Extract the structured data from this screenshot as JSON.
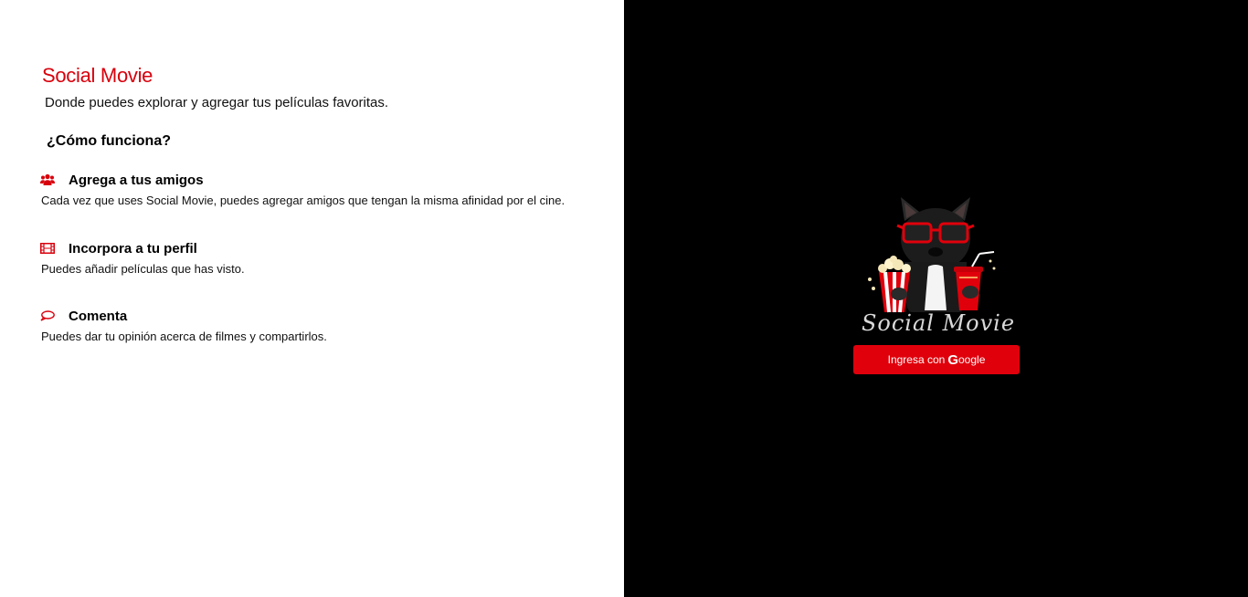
{
  "intro": {
    "title": "Social Movie",
    "tagline": "Donde puedes explorar y agregar tus películas favoritas."
  },
  "how_it_works": {
    "heading": "¿Cómo funciona?",
    "features": [
      {
        "icon": "users-icon",
        "title": "Agrega a tus amigos",
        "description": "Cada vez que uses Social Movie, puedes agregar amigos que tengan la misma afinidad por el cine."
      },
      {
        "icon": "film-icon",
        "title": "Incorpora a tu perfil",
        "description": "Puedes añadir películas que has visto."
      },
      {
        "icon": "comment-icon",
        "title": "Comenta",
        "description": "Puedes dar tu opinión acerca de filmes y compartirlos."
      }
    ]
  },
  "login": {
    "logo_text": "Social Movie",
    "button_prefix": "Ingresa con ",
    "button_brand_g": "G",
    "button_brand_rest": "oogle"
  },
  "colors": {
    "accent": "#d8000c",
    "button": "#e0000b",
    "right_panel": "#000000",
    "left_panel": "#ffffff"
  }
}
